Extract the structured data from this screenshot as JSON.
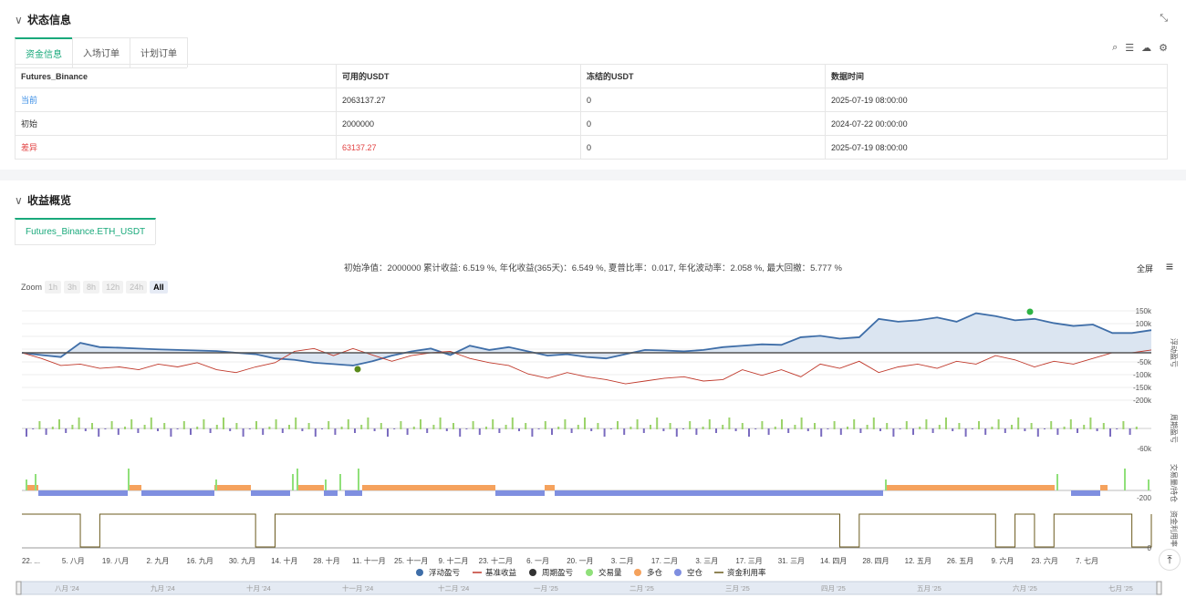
{
  "status": {
    "title": "状态信息",
    "tabs": [
      "资金信息",
      "入场订单",
      "计划订单"
    ],
    "table": {
      "headers": [
        "Futures_Binance",
        "可用的USDT",
        "冻结的USDT",
        "数据时间"
      ],
      "rows": [
        [
          "当前",
          "2063137.27",
          "0",
          "2025-07-19 08:00:00"
        ],
        [
          "初始",
          "2000000",
          "0",
          "2024-07-22 00:00:00"
        ],
        [
          "差异",
          "63137.27",
          "0",
          "2025-07-19 08:00:00"
        ]
      ]
    }
  },
  "profit": {
    "title": "收益概览",
    "tab": "Futures_Binance.ETH_USDT",
    "summary": "初始净值：2000000 累计收益: 6.519 %, 年化收益(365天)：6.549 %, 夏普比率：0.017, 年化波动率：2.058 %, 最大回撤：5.777 %",
    "fullscreen": "全屏",
    "zoom_label": "Zoom",
    "zoom_buttons": [
      "1h",
      "3h",
      "8h",
      "12h",
      "24h",
      "All"
    ]
  },
  "chart_data": {
    "type": "line",
    "x_ticks": [
      "22. ...",
      "5. 八月",
      "19. 八月",
      "2. 九月",
      "16. 九月",
      "30. 九月",
      "14. 十月",
      "28. 十月",
      "11. 十一月",
      "25. 十一月",
      "9. 十二月",
      "23. 十二月",
      "6. 一月",
      "20. 一月",
      "3. 二月",
      "17. 二月",
      "3. 三月",
      "17. 三月",
      "31. 三月",
      "14. 四月",
      "28. 四月",
      "12. 五月",
      "26. 五月",
      "9. 六月",
      "23. 六月",
      "7. 七月"
    ],
    "axis_main": [
      "150k",
      "100k",
      "50k",
      "0",
      "-50k",
      "-100k",
      "-150k",
      "-200k"
    ],
    "axis_main_title": "浮动盈亏",
    "axis_period": [
      "-60k"
    ],
    "axis_period_title": "周期盈亏",
    "axis_volume": [
      "-200"
    ],
    "axis_volume_title": "交易量/持仓",
    "axis_util": [
      "0"
    ],
    "axis_util_title": "资金利用率",
    "legend": [
      "浮动盈亏",
      "基准收益",
      "周期盈亏",
      "交易量",
      "多仓",
      "空仓",
      "资金利用率"
    ],
    "navigator": [
      "八月 '24",
      "九月 '24",
      "十月 '24",
      "十一月 '24",
      "十二月 '24",
      "一月 '25",
      "二月 '25",
      "三月 '25",
      "四月 '25",
      "五月 '25",
      "六月 '25",
      "七月 '25"
    ],
    "series": [
      {
        "name": "浮动盈亏",
        "values": [
          0,
          -8,
          -15,
          35,
          20,
          18,
          15,
          12,
          10,
          8,
          6,
          0,
          -5,
          -20,
          -25,
          -35,
          -40,
          -45,
          -30,
          -10,
          5,
          15,
          -8,
          25,
          10,
          20,
          5,
          -10,
          -5,
          -15,
          -20,
          -5,
          10,
          8,
          5,
          10,
          20,
          25,
          30,
          28,
          55,
          60,
          50,
          55,
          120,
          110,
          115,
          125,
          110,
          140,
          130,
          115,
          120,
          105,
          95,
          100,
          70,
          70,
          80
        ]
      },
      {
        "name": "基准收益",
        "values": [
          0,
          -20,
          -45,
          -40,
          -55,
          -50,
          -60,
          -40,
          -50,
          -35,
          -60,
          -70,
          -50,
          -35,
          5,
          15,
          -10,
          15,
          -8,
          -30,
          -10,
          0,
          5,
          -20,
          -35,
          -45,
          -75,
          -90,
          -70,
          -85,
          -95,
          -110,
          -100,
          -90,
          -85,
          -100,
          -95,
          -60,
          -80,
          -60,
          -85,
          -40,
          -55,
          -30,
          -70,
          -50,
          -40,
          -55,
          -30,
          -40,
          -10,
          -25,
          -50,
          -30,
          -40,
          -20,
          0,
          0,
          10
        ]
      },
      {
        "name": "资金利用率",
        "values": [
          100,
          100,
          100,
          0,
          100,
          100,
          100,
          100,
          100,
          100,
          100,
          100,
          0,
          100,
          100,
          100,
          100,
          100,
          100,
          100,
          100,
          100,
          100,
          100,
          100,
          100,
          100,
          100,
          100,
          100,
          100,
          100,
          100,
          100,
          100,
          100,
          100,
          100,
          100,
          100,
          100,
          100,
          0,
          100,
          100,
          100,
          100,
          100,
          100,
          100,
          0,
          100,
          0,
          100,
          100,
          100,
          100,
          0,
          100
        ]
      }
    ]
  },
  "colors": {
    "accent": "#19a97b",
    "float": "#3f6ea8",
    "bench": "#c0392b",
    "long": "#f5a25d",
    "short": "#7f8fe0",
    "volume": "#90e07a",
    "util": "#6b5a1e"
  }
}
